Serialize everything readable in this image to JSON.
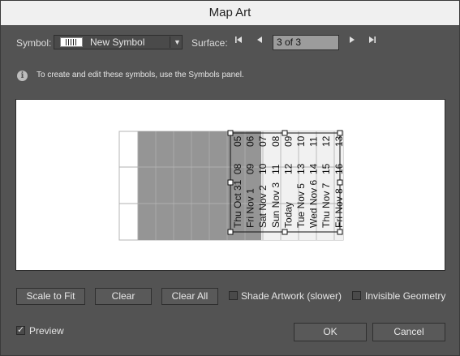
{
  "window": {
    "title": "Map Art"
  },
  "symbol": {
    "label": "Symbol:",
    "value": "New Symbol"
  },
  "surface": {
    "label": "Surface:",
    "value": "3 of 3"
  },
  "info": {
    "text": "To create and edit these symbols, use the Symbols panel."
  },
  "art": {
    "labels": [
      "Thu Oct 31",
      "Fri Nov 1",
      "Sat Nov 2",
      "Sun Nov 3",
      "Today",
      "Tue Nov 5",
      "Wed Nov 6",
      "Thu Nov 7",
      "Fri Nov 8"
    ],
    "numbers": [
      [
        "08",
        "05"
      ],
      [
        "09",
        "06"
      ],
      [
        "10",
        "07"
      ],
      [
        "11",
        "08"
      ],
      [
        "12",
        "09"
      ],
      [
        "13",
        "10"
      ],
      [
        "14",
        "11"
      ],
      [
        "15",
        "12"
      ],
      [
        "16",
        "13"
      ]
    ]
  },
  "buttons": {
    "scale_to_fit": "Scale to Fit",
    "clear": "Clear",
    "clear_all": "Clear All",
    "ok": "OK",
    "cancel": "Cancel"
  },
  "options": {
    "shade_artwork": {
      "label": "Shade Artwork (slower)",
      "checked": false
    },
    "invisible_geometry": {
      "label": "Invisible Geometry",
      "checked": false
    },
    "preview": {
      "label": "Preview",
      "checked": true
    }
  },
  "icons": {
    "info": "info-icon",
    "first": "first-page-icon",
    "prev": "previous-icon",
    "next": "next-icon",
    "last": "last-page-icon",
    "dropdown": "chevron-down-icon"
  }
}
